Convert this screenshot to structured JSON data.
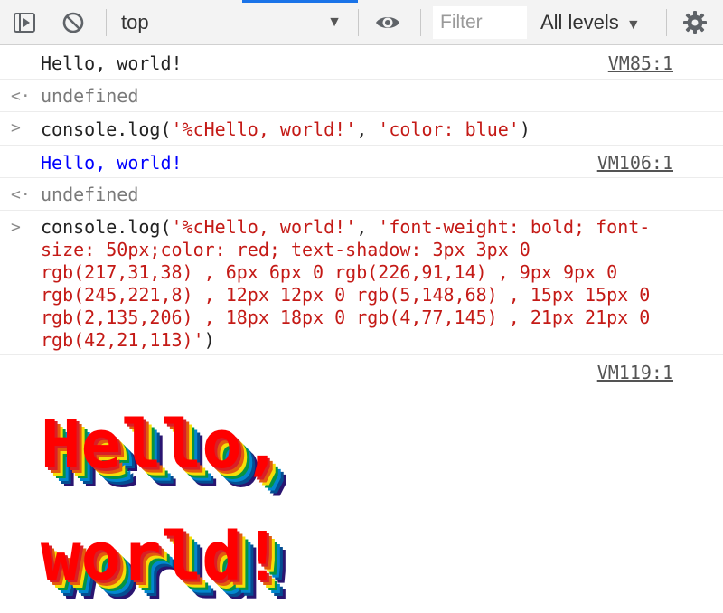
{
  "toolbar": {
    "context": "top",
    "filter_placeholder": "Filter",
    "levels": "All levels"
  },
  "console": [
    {
      "kind": "output",
      "text": "Hello, world!",
      "source": "VM85:1"
    },
    {
      "kind": "result",
      "text": "undefined"
    },
    {
      "kind": "input",
      "prefix": "console.log(",
      "arg1": "'%cHello, world!'",
      "sep": ", ",
      "arg2": "'color: blue'",
      "suffix": ")"
    },
    {
      "kind": "output",
      "text": "Hello, world!",
      "source": "VM106:1",
      "color": "#0000ff"
    },
    {
      "kind": "result",
      "text": "undefined"
    },
    {
      "kind": "input",
      "prefix": "console.log(",
      "arg1": "'%cHello, world!'",
      "sep": ", ",
      "arg2_lines": [
        "'font-weight: bold; font-",
        "size: 50px;color: red; text-shadow: 3px 3px 0",
        "rgb(217,31,38) , 6px 6px 0 rgb(226,91,14) , 9px 9px 0",
        "rgb(245,221,8) , 12px 12px 0 rgb(5,148,68) , 15px 15px 0",
        "rgb(2,135,206) , 18px 18px 0 rgb(4,77,145) , 21px 21px 0",
        "rgb(42,21,113)'"
      ],
      "suffix": ")"
    },
    {
      "kind": "output",
      "text": "Hello, world!",
      "source": "VM119:1",
      "styled": true
    }
  ],
  "colors": {
    "accent": "#1a73e8",
    "string": "#c41a16",
    "blue_output": "#0000ff",
    "red_output": "#ff0000"
  },
  "icons": {
    "sidebar_toggle": "sidebar-toggle-icon",
    "clear": "clear-console-icon",
    "eye": "eye-icon",
    "settings": "gear-icon"
  }
}
